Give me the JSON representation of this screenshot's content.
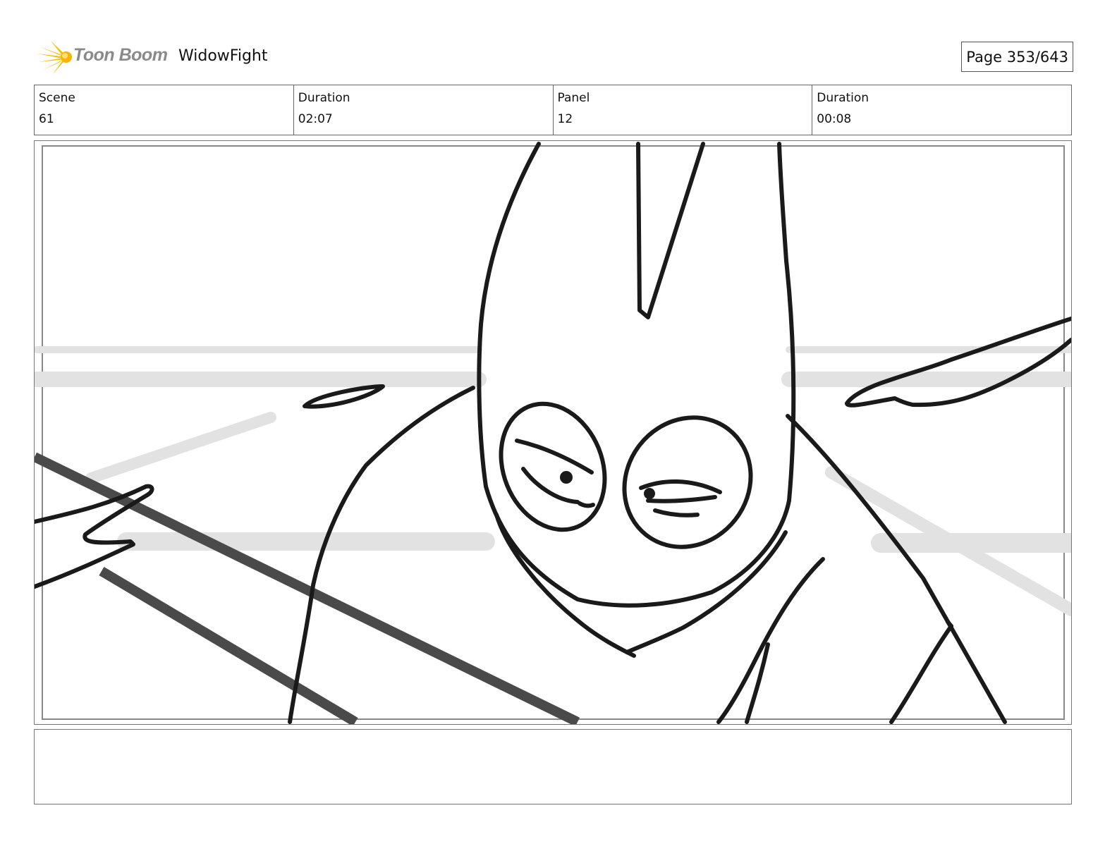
{
  "header": {
    "brand": "Toon Boom",
    "project": "WidowFight",
    "page": "Page 353/643"
  },
  "info": {
    "scene_label": "Scene",
    "scene_value": "61",
    "scene_duration_label": "Duration",
    "scene_duration_value": "02:07",
    "panel_label": "Panel",
    "panel_value": "12",
    "panel_duration_label": "Duration",
    "panel_duration_value": "00:08"
  },
  "notes": {
    "text": ""
  },
  "icons": {
    "logo": "toon-boom-logo-icon"
  },
  "colors": {
    "logo_yellow": "#f5c000",
    "line": "#1a1a1a",
    "bg_tone": "#e4e4e4"
  }
}
